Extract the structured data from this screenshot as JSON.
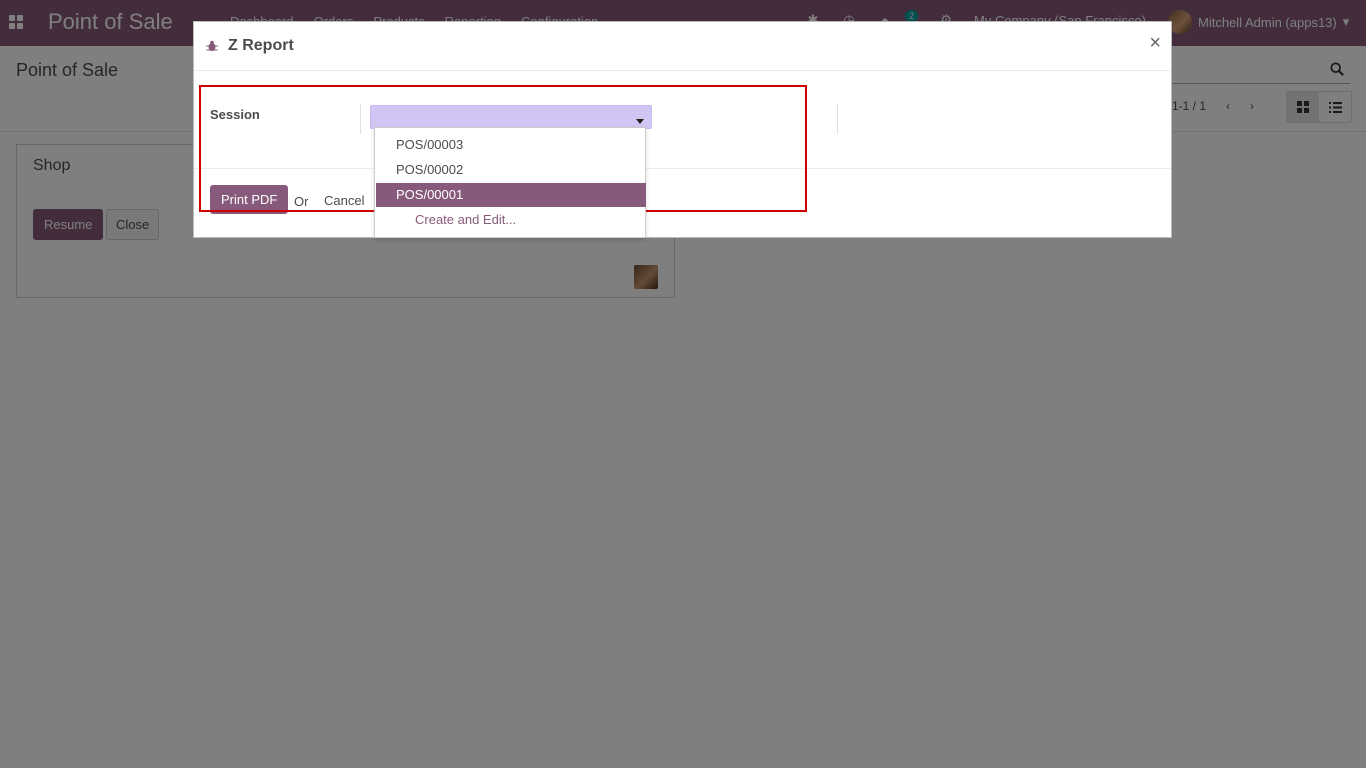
{
  "navbar": {
    "app_name": "Point of Sale",
    "menu": [
      "Dashboard",
      "Orders",
      "Products",
      "Reporting",
      "Configuration"
    ],
    "message_count": "2",
    "company": "My Company (San Francisco)",
    "user": "Mitchell Admin (apps13)"
  },
  "control_panel": {
    "breadcrumb": "Point of Sale",
    "pager": "1-1 / 1"
  },
  "card": {
    "title": "Shop",
    "resume_label": "Resume",
    "close_label": "Close"
  },
  "modal": {
    "title": "Z Report",
    "close_symbol": "×",
    "field_label": "Session",
    "print_label": "Print PDF",
    "or_text": "Or",
    "cancel_label": "Cancel"
  },
  "dropdown": {
    "options": [
      "POS/00003",
      "POS/00002",
      "POS/00001"
    ],
    "create_label": "Create and Edit..."
  },
  "colors": {
    "brand": "#875a7b",
    "select_bg": "#d1c6f3",
    "highlight": "#d00000",
    "accent_badge": "#00a09d"
  }
}
